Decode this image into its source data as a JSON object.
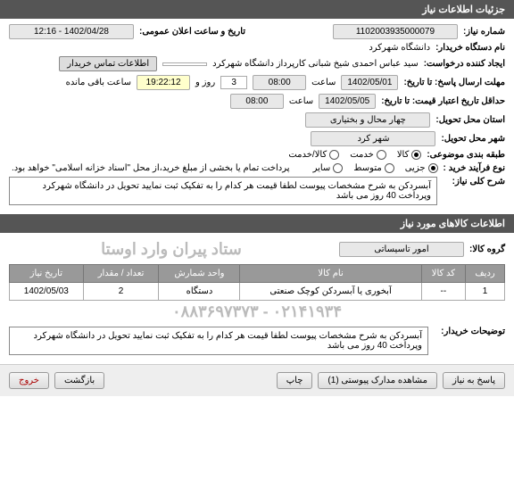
{
  "sections": {
    "need_details": "جزئیات اطلاعات نیاز",
    "goods_info": "اطلاعات کالاهای مورد نیاز"
  },
  "fields": {
    "need_number_label": "شماره نیاز:",
    "need_number": "1102003935000079",
    "announce_label": "تاریخ و ساعت اعلان عمومی:",
    "announce_value": "1402/04/28 - 12:16",
    "buyer_org_label": "نام دستگاه خریدار:",
    "buyer_org": "دانشگاه شهرکرد",
    "requester_label": "ایجاد کننده درخواست:",
    "requester": "سید عباس احمدی شیخ شبانی کارپرداز دانشگاه شهرکرد",
    "contact_btn": "اطلاعات تماس خریدار",
    "deadline_label": "مهلت ارسال پاسخ: تا تاریخ:",
    "deadline_date": "1402/05/01",
    "time_label": "ساعت",
    "deadline_time": "08:00",
    "day_and": "روز و",
    "days_left": "3",
    "hours_left": "19:22:12",
    "remaining": "ساعت باقی مانده",
    "validity_label": "حداقل تاریخ اعتبار قیمت: تا تاریخ:",
    "validity_date": "1402/05/05",
    "validity_time": "08:00",
    "location_label": "استان محل تحویل:",
    "location": "چهار محال و بختیاری",
    "city_label": "شهر محل تحویل:",
    "city": "شهر کرد",
    "category_label": "طبقه بندی موضوعی:",
    "purchase_type_label": "نوع فرآیند خرید :",
    "payment_note": "پرداخت تمام یا بخشی از مبلغ خرید،از محل \"اسناد خزانه اسلامی\" خواهد بود.",
    "desc_label": "شرح کلی نیاز:",
    "desc_text": "آبسردکن به شرح مشخصات پیوست لطفا قیمت هر کدام را به تفکیک ثبت نمایید تحویل در دانشگاه شهرکرد وپرداخت 40 روز می باشد",
    "goods_group_label": "گروه کالا:",
    "goods_group": "امور تاسیساتی",
    "buyer_notes_label": "توضیحات خریدار:",
    "buyer_notes": "آبسردکن به شرح مشخصات پیوست لطفا قیمت هر کدام را به تفکیک ثبت نمایید تحویل در دانشگاه شهرکرد وپرداخت 40 روز می باشد"
  },
  "radios": {
    "cat": {
      "goods": "کالا",
      "service": "خدمت",
      "both": "کالا/خدمت"
    },
    "ptype": {
      "partial": "جزیی",
      "medium": "متوسط",
      "other": "سایر"
    }
  },
  "table": {
    "headers": {
      "row": "ردیف",
      "code": "کد کالا",
      "name": "نام کالا",
      "unit": "واحد شمارش",
      "qty": "تعداد / مقدار",
      "date": "تاریخ نیاز"
    },
    "rows": [
      {
        "row": "1",
        "code": "--",
        "name": "آبخوری یا آبسردکن کوچک صنعتی",
        "unit": "دستگاه",
        "qty": "2",
        "date": "1402/05/03"
      }
    ]
  },
  "watermark1": "ستاد پیران وارد اوستا",
  "watermark2": "۰۲۱۴۱۹۳۴ - ۰۸۸۳۶۹۷۳۷۳",
  "buttons": {
    "respond": "پاسخ به نیاز",
    "attachments": "مشاهده مدارک پیوستی (1)",
    "print": "چاپ",
    "back": "بازگشت",
    "exit": "خروج"
  }
}
